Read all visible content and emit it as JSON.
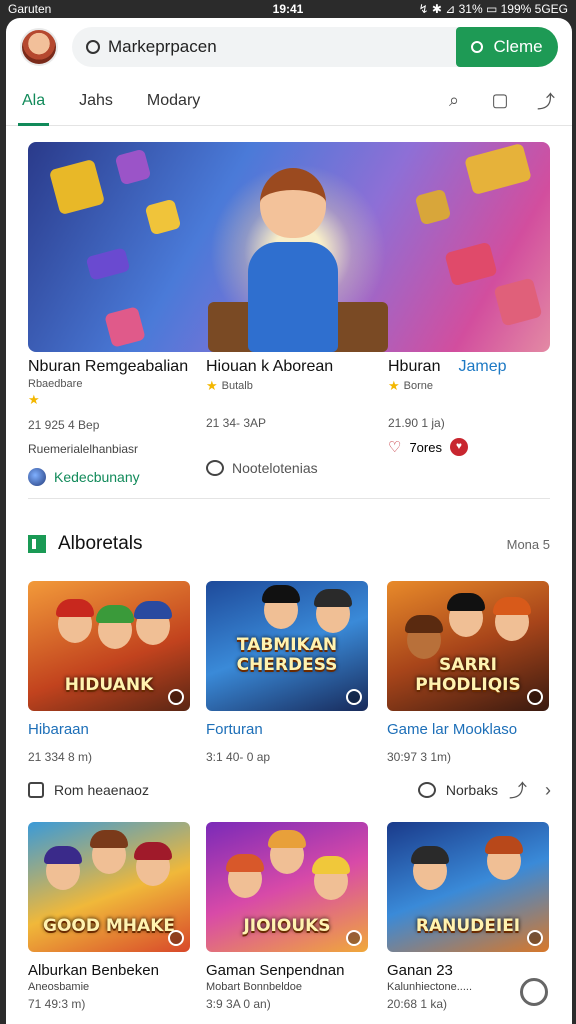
{
  "status": {
    "left": "Garuten",
    "time": "19:41",
    "right": "↯ ✱ ⊿ 31% ▭ 199% 5GEG"
  },
  "search": {
    "text": "Markeprpacen",
    "button": "Clemе"
  },
  "tabs": [
    {
      "label": "Ala"
    },
    {
      "label": "Jahs"
    },
    {
      "label": "Modary"
    }
  ],
  "featured": [
    {
      "title": "Nburan Remgeabalian",
      "sub": "Rbaedbare",
      "meta": "21 925 4 Bep",
      "line2": "Ruemerialelhanbiasr",
      "author": "Kedecbunany"
    },
    {
      "title": "Hiouan k Aborean",
      "sub": "Butalb",
      "meta": "21 34- 3AP",
      "author": "Nootelotenias"
    },
    {
      "title": "Hburan",
      "title_link": "Jamep",
      "sub": "Borne",
      "meta": "21.90 1 ja)",
      "likes": "7ores"
    }
  ],
  "section": {
    "title": "Alboretals",
    "more": "Mona 5"
  },
  "cards": [
    {
      "art": "HIDUANK",
      "title": "Hibaraan",
      "meta": "21 334 8 m)"
    },
    {
      "art": "TABMIKAN CHERDESS",
      "title": "Forturan",
      "meta": "3:1 40- 0 ap"
    },
    {
      "art": "SARRI PHODLIQIS",
      "title": "Game lar Mooklaso",
      "meta": "30:97 3 1m)"
    },
    {
      "art": "GOOD MHAKE",
      "title": "Alburkan Benbeken",
      "sub": "Aneosbamie",
      "meta": "71 49:3 m)"
    },
    {
      "art": "JIOIOUKS",
      "title": "Gaman Senpendnan",
      "sub": "Mobart Bonnbeldoe",
      "meta": "3:9 3A 0 an)"
    },
    {
      "art": "RANUDEIEI",
      "title": "Ganan 23",
      "sub": "Kalunhiectone.....",
      "meta": "20:68 1 ka)"
    }
  ],
  "actions": {
    "left": "Rom heaenaoz",
    "right": "Norbaks"
  },
  "colors": {
    "accent": "#118a5a",
    "button": "#1e9a55",
    "link": "#1d79c4"
  }
}
